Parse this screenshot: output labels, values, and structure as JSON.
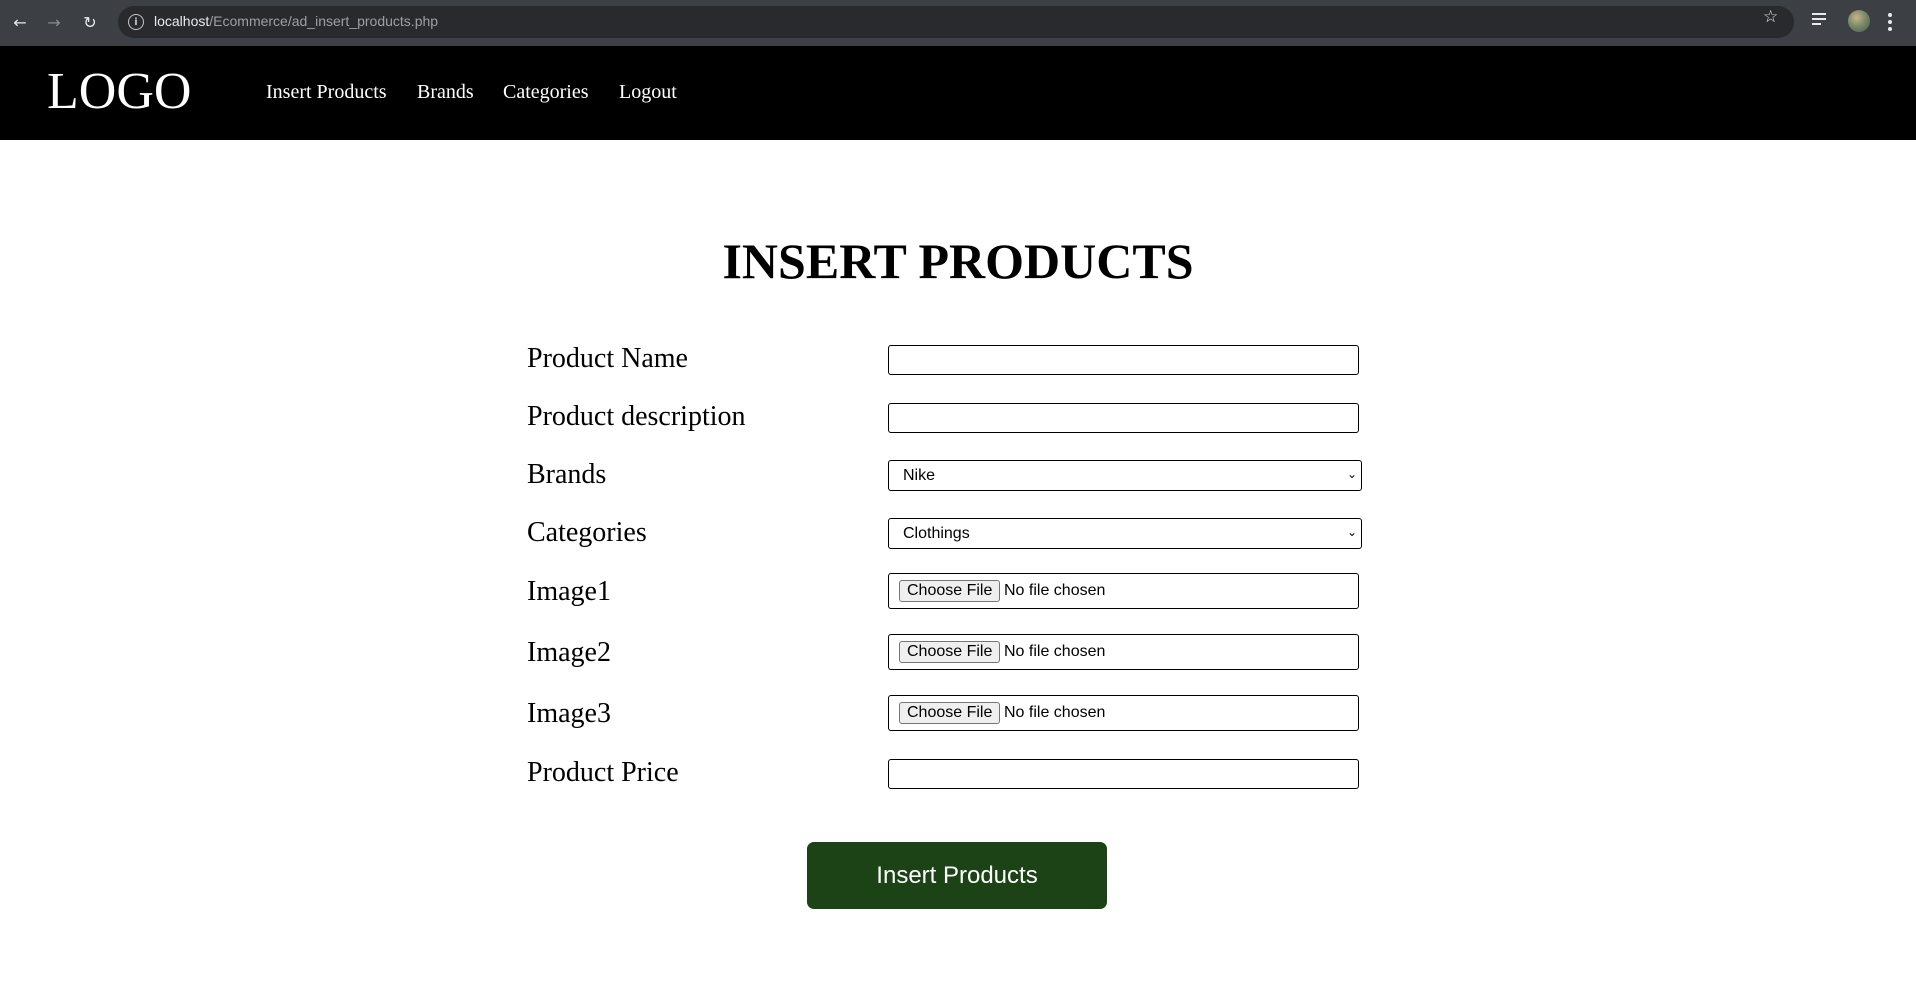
{
  "browser": {
    "url_host": "localhost",
    "url_path": "/Ecommerce/ad_insert_products.php",
    "icons": [
      "back-arrow-icon",
      "forward-arrow-icon",
      "reload-icon",
      "site-info-icon",
      "star-icon",
      "media-controls-icon",
      "profile-avatar-icon",
      "kebab-menu-icon"
    ]
  },
  "header": {
    "logo": "LOGO",
    "nav": {
      "insert_products": "Insert Products",
      "brands": "Brands",
      "categories": "Categories",
      "logout": "Logout"
    },
    "background_color": "#000000"
  },
  "main": {
    "title": "INSERT PRODUCTS",
    "fields": {
      "product_name": {
        "label": "Product Name",
        "value": ""
      },
      "product_description": {
        "label": "Product description",
        "value": ""
      },
      "brands": {
        "label": "Brands",
        "selected": "Nike"
      },
      "categories": {
        "label": "Categories",
        "selected": "Clothings"
      },
      "image1": {
        "label": "Image1",
        "button": "Choose File",
        "status": "No file chosen"
      },
      "image2": {
        "label": "Image2",
        "button": "Choose File",
        "status": "No file chosen"
      },
      "image3": {
        "label": "Image3",
        "button": "Choose File",
        "status": "No file chosen"
      },
      "product_price": {
        "label": "Product Price",
        "value": ""
      }
    },
    "submit_label": "Insert Products",
    "submit_color": "#1b4316"
  }
}
